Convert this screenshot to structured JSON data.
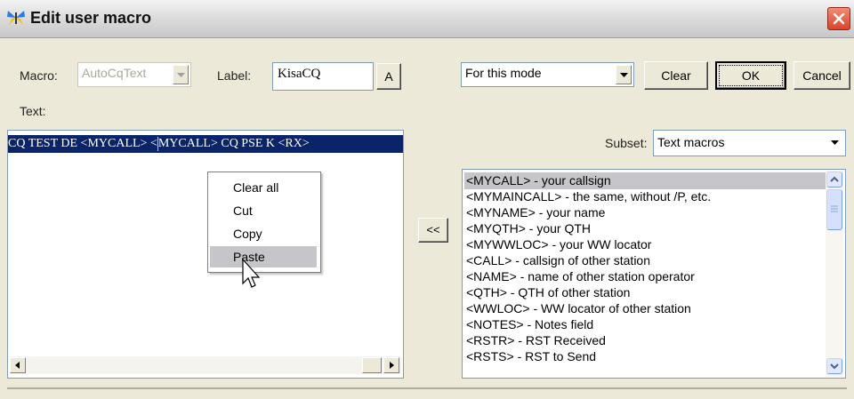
{
  "window": {
    "title": "Edit user macro",
    "title_icon": "butterfly-icon",
    "close_icon": "close-icon"
  },
  "macro": {
    "label": "Macro:",
    "value": "AutoCqText"
  },
  "label_field": {
    "label": "Label:",
    "value": "KisaCQ",
    "font_button": "A"
  },
  "text_label": "Text:",
  "text_content": {
    "before": " CQ TEST DE <MYCALL> <",
    "after": "MYCALL> CQ PSE K <RX>"
  },
  "mode_select": {
    "value": "For this mode"
  },
  "buttons": {
    "clear": "Clear",
    "ok": "OK",
    "cancel": "Cancel",
    "insert": "<<"
  },
  "subset": {
    "label": "Subset:",
    "value": "Text macros"
  },
  "context_menu": [
    "Clear all",
    "Cut",
    "Copy",
    "Paste"
  ],
  "macro_list": [
    "<MYCALL> - your callsign",
    "<MYMAINCALL> - the same, without /P, etc.",
    "<MYNAME> - your name",
    "<MYQTH> - your QTH",
    "<MYWWLOC> - your WW locator",
    "<CALL> - callsign of other station",
    "<NAME> - name of other station operator",
    "<QTH> - QTH of other station",
    "<WWLOC> - WW locator of other station",
    "<NOTES> - Notes field",
    "<RSTR> - RST Received",
    "<RSTS> - RST to Send"
  ],
  "colors": {
    "selection": "#0a246a",
    "list_highlight": "#c6c6ca",
    "face": "#ece9d8"
  }
}
